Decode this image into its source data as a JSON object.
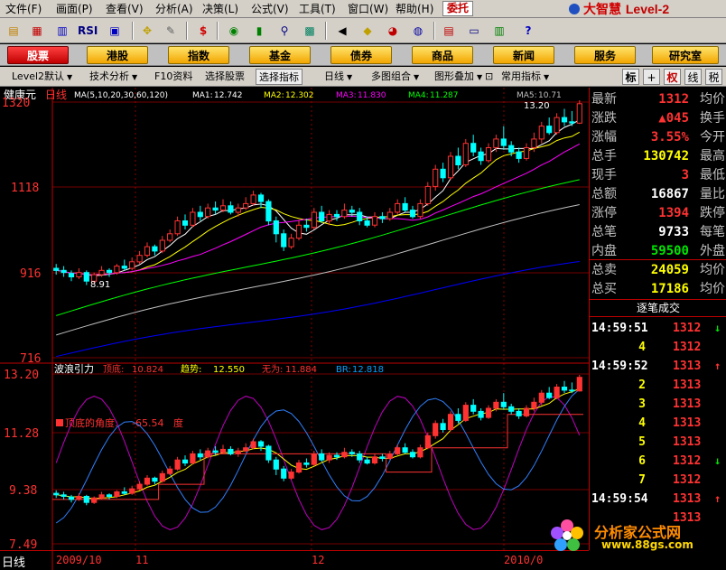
{
  "menu": {
    "items": [
      "文件(F)",
      "画面(P)",
      "查看(V)",
      "分析(A)",
      "决策(L)",
      "公式(V)",
      "工具(T)",
      "窗口(W)",
      "帮助(H)"
    ],
    "trust_button": "委托",
    "brand": "大智慧",
    "brand_level": "Level-2"
  },
  "toolbar": {
    "rsi_label": "RSI"
  },
  "nav": {
    "buttons": [
      "股票",
      "港股",
      "指数",
      "基金",
      "债券",
      "商品",
      "新闻",
      "服务",
      "研究室"
    ],
    "active_index": 0
  },
  "subbar": {
    "items": [
      "Level2默认",
      "技术分析",
      "F10资料",
      "选择股票",
      "选择指标",
      "日线",
      "多图组合",
      "图形叠加",
      "常用指标"
    ],
    "right_buttons": [
      "标",
      "+",
      "权",
      "线",
      "税"
    ]
  },
  "main_chart": {
    "stock_name": "健康元",
    "period": "日线",
    "ma_params": "MA(5,10,20,30,60,120)",
    "ma1_label": "MA1:",
    "ma1_value": "12.742",
    "ma2_label": "MA2:",
    "ma2_value": "12.302",
    "ma3_label": "MA3:",
    "ma3_value": "11.830",
    "ma4_label": "MA4:",
    "ma4_value": "11.287",
    "ma5_label": "MA5:",
    "ma5_value": "10.71",
    "y_ticks": [
      "1320",
      "1118",
      "916",
      "716"
    ],
    "high_label": "13.20",
    "low_label": "8.91"
  },
  "sub_chart": {
    "name": "波浪引力",
    "top_label": "顶底:",
    "top_value": "10.824",
    "trend_label": "趋势:",
    "trend_value": "12.550",
    "none_label": "无为:",
    "none_value": "11.884",
    "br_label": "BR:",
    "br_value": "12.818",
    "angle_label": "顶底的角度:",
    "angle_value": "-65.54",
    "angle_unit": "度",
    "y_ticks": [
      "13.20",
      "11.28",
      "9.38",
      "7.49"
    ]
  },
  "x_axis": {
    "labels": [
      "2009/10",
      "11",
      "12",
      "2010/0"
    ]
  },
  "bottom": {
    "period_label": "日线"
  },
  "quote": {
    "rows": [
      {
        "label": "最新",
        "value": "1312",
        "label2": "均价",
        "color": "red"
      },
      {
        "label": "涨跌",
        "value": "▲045",
        "label2": "换手",
        "color": "red"
      },
      {
        "label": "涨幅",
        "value": "3.55%",
        "label2": "今开",
        "color": "red"
      },
      {
        "label": "总手",
        "value": "130742",
        "label2": "最高",
        "color": "yel"
      },
      {
        "label": "现手",
        "value": "3",
        "label2": "最低",
        "color": "red"
      },
      {
        "label": "总额",
        "value": "16867",
        "label2": "量比",
        "color": "wht"
      },
      {
        "label": "涨停",
        "value": "1394",
        "label2": "跌停",
        "color": "red"
      },
      {
        "label": "总笔",
        "value": "9733",
        "label2": "每笔",
        "color": "wht"
      },
      {
        "label": "内盘",
        "value": "59500",
        "label2": "外盘",
        "color": "grn"
      }
    ],
    "rows2": [
      {
        "label": "总卖",
        "value": "24059",
        "label2": "均价",
        "color": "yel"
      },
      {
        "label": "总买",
        "value": "17186",
        "label2": "均价",
        "color": "yel"
      }
    ]
  },
  "ticks": {
    "title": "逐笔成交",
    "rows": [
      {
        "time": "14:59:51",
        "vol": "",
        "price": "1312",
        "dir": "down"
      },
      {
        "time": "",
        "vol": "4",
        "price": "1312",
        "dir": ""
      },
      {
        "time": "14:59:52",
        "vol": "",
        "price": "1313",
        "dir": "up"
      },
      {
        "time": "",
        "vol": "2",
        "price": "1313",
        "dir": ""
      },
      {
        "time": "",
        "vol": "3",
        "price": "1313",
        "dir": ""
      },
      {
        "time": "",
        "vol": "4",
        "price": "1313",
        "dir": ""
      },
      {
        "time": "",
        "vol": "5",
        "price": "1313",
        "dir": ""
      },
      {
        "time": "",
        "vol": "6",
        "price": "1312",
        "dir": "down"
      },
      {
        "time": "",
        "vol": "7",
        "price": "1312",
        "dir": ""
      },
      {
        "time": "14:59:54",
        "vol": "",
        "price": "1313",
        "dir": "up"
      },
      {
        "time": "",
        "vol": "",
        "price": "1313",
        "dir": ""
      }
    ]
  },
  "watermark": {
    "text": "分析家公式网",
    "url": "www.88gs.com"
  },
  "colors": {
    "up": "#ff3232",
    "down": "#00ffff",
    "grid": "#c00000",
    "ma1": "#ffffff",
    "ma2": "#ffff00",
    "ma3": "#ff00ff",
    "ma4": "#00ff00",
    "ma5": "#c0c0c0",
    "ma6": "#0000ff"
  },
  "chart_data": {
    "type": "candlestick",
    "price_range": [
      7.16,
      13.2
    ],
    "candles": [
      [
        9.3,
        9.25,
        9.4,
        9.15
      ],
      [
        9.25,
        9.2,
        9.35,
        9.1
      ],
      [
        9.18,
        9.1,
        9.25,
        9.0
      ],
      [
        9.1,
        9.2,
        9.3,
        9.05
      ],
      [
        9.2,
        9.0,
        9.25,
        8.91
      ],
      [
        9.0,
        9.15,
        9.2,
        8.95
      ],
      [
        9.15,
        9.25,
        9.35,
        9.1
      ],
      [
        9.25,
        9.2,
        9.3,
        9.1
      ],
      [
        9.2,
        9.35,
        9.4,
        9.15
      ],
      [
        9.35,
        9.3,
        9.5,
        9.25
      ],
      [
        9.3,
        9.45,
        9.55,
        9.25
      ],
      [
        9.45,
        9.6,
        9.7,
        9.4
      ],
      [
        9.6,
        9.8,
        9.9,
        9.55
      ],
      [
        9.8,
        9.7,
        9.85,
        9.6
      ],
      [
        9.7,
        9.95,
        10.05,
        9.65
      ],
      [
        9.95,
        10.1,
        10.2,
        9.9
      ],
      [
        10.1,
        10.4,
        10.5,
        10.05
      ],
      [
        10.4,
        10.3,
        10.55,
        10.2
      ],
      [
        10.3,
        10.6,
        10.7,
        10.25
      ],
      [
        10.6,
        10.5,
        10.75,
        10.4
      ],
      [
        10.5,
        10.7,
        10.8,
        10.45
      ],
      [
        10.7,
        10.65,
        10.85,
        10.55
      ],
      [
        10.65,
        10.75,
        10.9,
        10.6
      ],
      [
        10.75,
        10.6,
        10.85,
        10.55
      ],
      [
        10.6,
        10.7,
        10.8,
        10.5
      ],
      [
        10.7,
        10.8,
        10.95,
        10.65
      ],
      [
        10.8,
        11.0,
        11.1,
        10.75
      ],
      [
        11.0,
        10.85,
        11.05,
        10.7
      ],
      [
        10.85,
        10.4,
        10.9,
        10.3
      ],
      [
        10.4,
        10.1,
        10.5,
        9.9
      ],
      [
        10.1,
        9.8,
        10.2,
        9.7
      ],
      [
        9.8,
        10.0,
        10.1,
        9.75
      ],
      [
        10.0,
        10.3,
        10.4,
        9.95
      ],
      [
        10.3,
        10.25,
        10.45,
        10.15
      ],
      [
        10.25,
        10.6,
        10.7,
        10.2
      ],
      [
        10.6,
        10.4,
        10.75,
        10.35
      ],
      [
        10.4,
        10.55,
        10.65,
        10.3
      ],
      [
        10.55,
        10.5,
        10.65,
        10.4
      ],
      [
        10.5,
        10.65,
        10.8,
        10.45
      ],
      [
        10.65,
        10.6,
        10.75,
        10.5
      ],
      [
        10.6,
        10.4,
        10.7,
        10.3
      ],
      [
        10.4,
        10.3,
        10.5,
        10.25
      ],
      [
        10.3,
        10.5,
        10.6,
        10.25
      ],
      [
        10.5,
        10.45,
        10.6,
        10.35
      ],
      [
        10.45,
        10.6,
        10.7,
        10.4
      ],
      [
        10.6,
        10.8,
        10.9,
        10.55
      ],
      [
        10.8,
        10.65,
        10.95,
        10.6
      ],
      [
        10.65,
        10.5,
        10.75,
        10.45
      ],
      [
        10.5,
        10.8,
        10.9,
        10.45
      ],
      [
        10.8,
        11.2,
        11.3,
        10.75
      ],
      [
        11.2,
        11.6,
        11.7,
        11.1
      ],
      [
        11.6,
        11.4,
        11.75,
        11.3
      ],
      [
        11.4,
        11.9,
        12.0,
        11.35
      ],
      [
        11.9,
        11.7,
        12.1,
        11.6
      ],
      [
        11.7,
        12.2,
        12.3,
        11.65
      ],
      [
        12.2,
        12.0,
        12.4,
        11.9
      ],
      [
        12.0,
        11.8,
        12.1,
        11.7
      ],
      [
        11.8,
        12.1,
        12.2,
        11.75
      ],
      [
        12.1,
        12.3,
        12.4,
        12.0
      ],
      [
        12.3,
        12.15,
        12.6,
        12.05
      ],
      [
        12.15,
        12.0,
        12.25,
        11.9
      ],
      [
        12.0,
        11.85,
        12.1,
        11.75
      ],
      [
        11.85,
        12.1,
        12.2,
        11.8
      ],
      [
        12.1,
        12.3,
        12.45,
        12.0
      ],
      [
        12.3,
        12.6,
        12.7,
        12.2
      ],
      [
        12.6,
        12.45,
        12.8,
        12.4
      ],
      [
        12.45,
        12.8,
        12.9,
        12.4
      ],
      [
        12.8,
        12.7,
        13.0,
        12.6
      ],
      [
        12.7,
        12.67,
        12.95,
        12.6
      ],
      [
        12.67,
        13.12,
        13.2,
        12.65
      ]
    ]
  }
}
